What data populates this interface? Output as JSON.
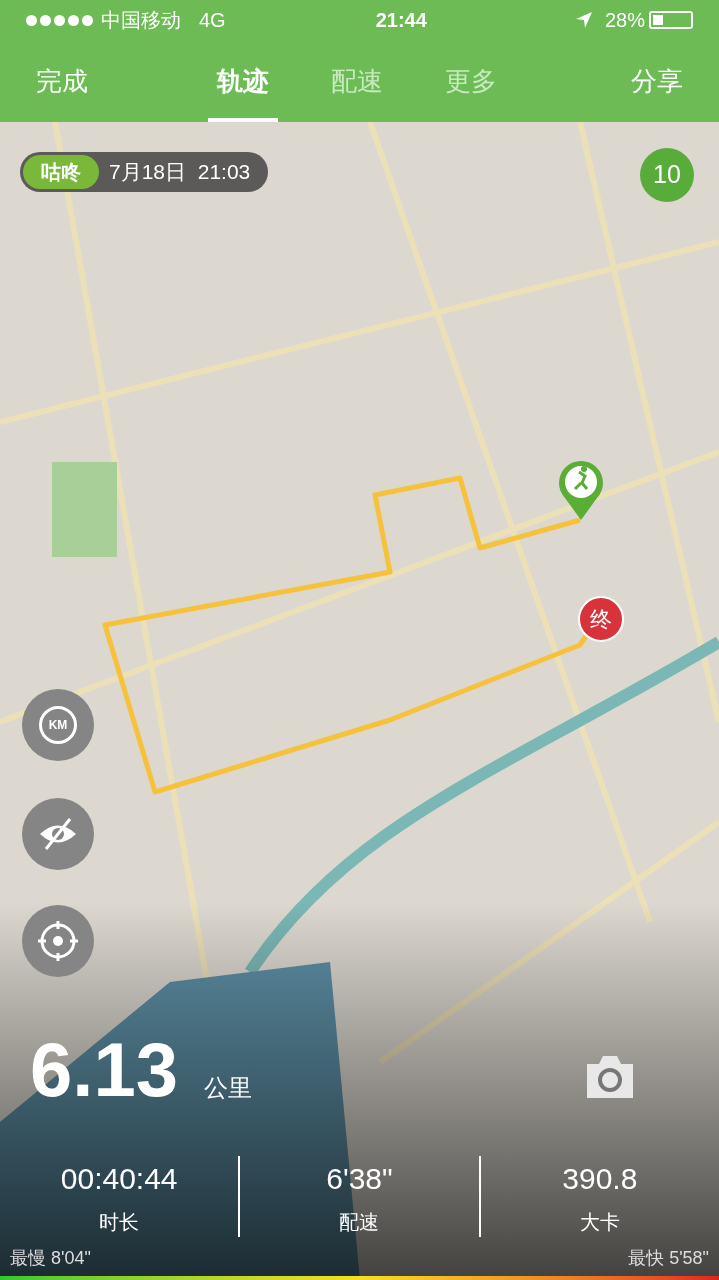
{
  "status_bar": {
    "carrier": "中国移动",
    "network": "4G",
    "time": "21:44",
    "battery": "28%"
  },
  "nav": {
    "left": "完成",
    "right": "分享",
    "tabs": [
      {
        "label": "轨迹",
        "selected": true
      },
      {
        "label": "配速",
        "selected": false
      },
      {
        "label": "更多",
        "selected": false
      }
    ]
  },
  "date_pill": {
    "tag": "咕咚",
    "datetime": "7月18日  21:03"
  },
  "count_badge": "10",
  "end_marker": "终",
  "map_controls": {
    "km_label": "KM"
  },
  "summary": {
    "distance": "6.13",
    "unit": "公里",
    "stats": [
      {
        "value": "00:40:44",
        "label": "时长"
      },
      {
        "value": "6'38\"",
        "label": "配速"
      },
      {
        "value": "390.8",
        "label": "大卡"
      }
    ],
    "slowest": "最慢 8'04\"",
    "fastest": "最快 5'58\""
  }
}
